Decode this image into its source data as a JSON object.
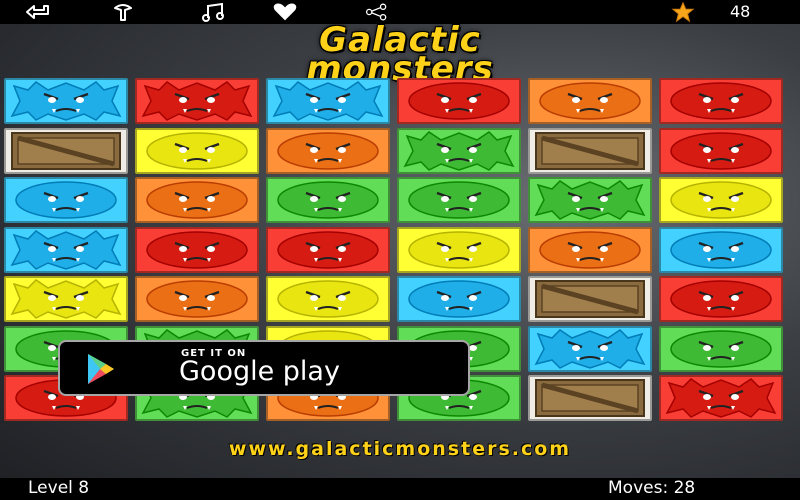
{
  "topbar": {
    "icons": [
      "back-icon",
      "share-pin-icon",
      "music-icon",
      "heart-icon",
      "share-icon",
      "star-icon"
    ],
    "score": "48"
  },
  "logo": {
    "line1": "Galactic",
    "line2": "monsters"
  },
  "board": {
    "cols": 6,
    "rows": 7,
    "tiles": [
      [
        "blue-spiky",
        "red-spiky",
        "blue-spiky",
        "red-round",
        "orange-round",
        "red-round"
      ],
      [
        "crate",
        "yellow-round",
        "orange-round",
        "green-spiky",
        "crate",
        "red-round"
      ],
      [
        "blue-round",
        "orange-round",
        "green-round",
        "green-round",
        "green-spiky",
        "yellow-round"
      ],
      [
        "blue-spiky",
        "red-round",
        "red-round",
        "yellow-round",
        "orange-round",
        "blue-round"
      ],
      [
        "yellow-spiky",
        "orange-round",
        "yellow-round",
        "blue-round",
        "crate",
        "red-round"
      ],
      [
        "green-round",
        "green-spiky",
        "yellow-round",
        "green-round",
        "blue-spiky",
        "green-round"
      ],
      [
        "red-round",
        "green-spiky",
        "orange-round",
        "green-round",
        "crate",
        "red-spiky"
      ]
    ]
  },
  "colors": {
    "blue": "#2ab8f2",
    "red": "#e0261c",
    "orange": "#f5791f",
    "yellow": "#f2ef1a",
    "green": "#49c43f",
    "crate": "#8a6b3f",
    "logo_yellow": "#ffd21a"
  },
  "badge": {
    "small": "GET IT ON",
    "name": "Google play"
  },
  "url": "www.galacticmonsters.com",
  "footer": {
    "level": "Level 8",
    "moves": "Moves: 28"
  }
}
